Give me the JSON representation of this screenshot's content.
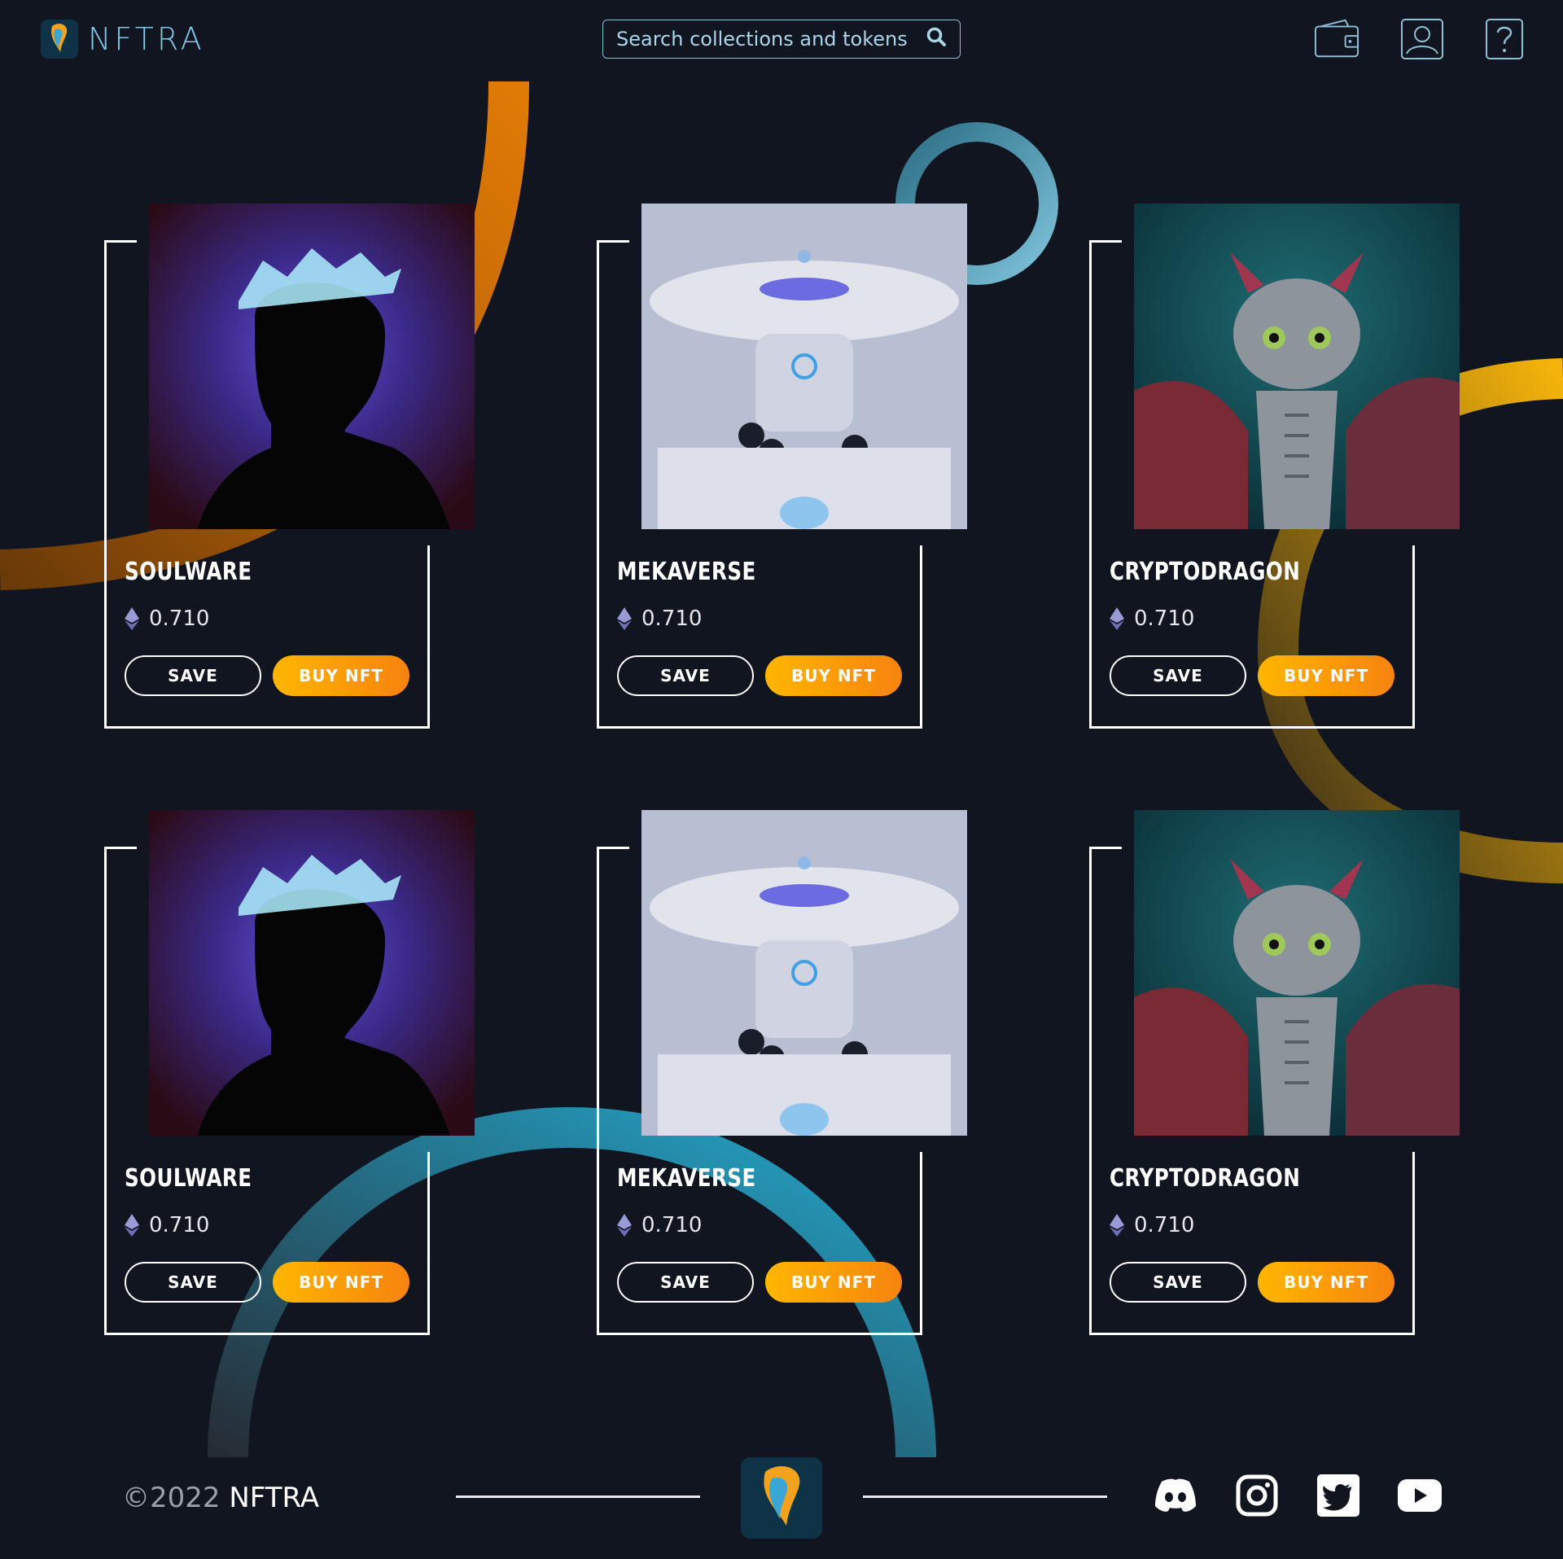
{
  "header": {
    "brand": "NFTRA",
    "search_placeholder": "Search collections and tokens",
    "icons": [
      "wallet-icon",
      "user-icon",
      "help-icon"
    ]
  },
  "cards": [
    {
      "name": "SOULWARE",
      "price": "0.710",
      "save_label": "SAVE",
      "buy_label": "BUY NFT"
    },
    {
      "name": "MEKAVERSE",
      "price": "0.710",
      "save_label": "SAVE",
      "buy_label": "BUY NFT"
    },
    {
      "name": "CRYPTODRAGON",
      "price": "0.710",
      "save_label": "SAVE",
      "buy_label": "BUY NFT"
    },
    {
      "name": "SOULWARE",
      "price": "0.710",
      "save_label": "SAVE",
      "buy_label": "BUY NFT"
    },
    {
      "name": "MEKAVERSE",
      "price": "0.710",
      "save_label": "SAVE",
      "buy_label": "BUY NFT"
    },
    {
      "name": "CRYPTODRAGON",
      "price": "0.710",
      "save_label": "SAVE",
      "buy_label": "BUY NFT"
    }
  ],
  "footer": {
    "copyright_symbol_year": "©2022",
    "copyright_brand": "NFTRA",
    "socials": [
      "discord-icon",
      "instagram-icon",
      "twitter-icon",
      "youtube-icon"
    ]
  },
  "colors": {
    "background": "#111520",
    "accent_orange": "#f7830f",
    "accent_yellow": "#ffb600",
    "accent_teal": "#2aa3c8"
  }
}
